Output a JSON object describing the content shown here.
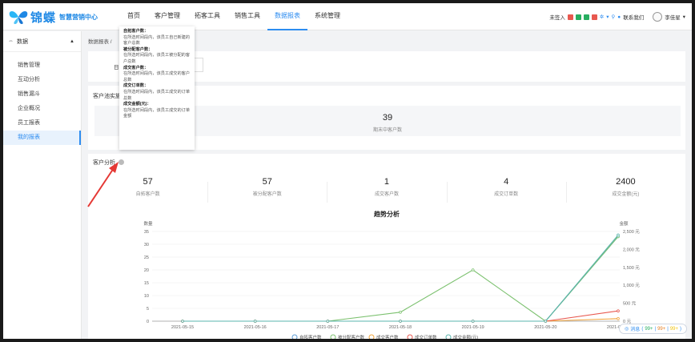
{
  "header": {
    "logo_text": "锦蝶",
    "logo_sub": "智慧营销中心",
    "nav": [
      "首页",
      "客户管理",
      "拓客工具",
      "销售工具",
      "数据报表",
      "系统管理"
    ],
    "nav_active_index": 4,
    "checkin_label": "未签入",
    "contact_label": "联系我们",
    "user_name": "李佳星"
  },
  "sidebar": {
    "group_label": "数据",
    "items": [
      "销售管理",
      "互动分析",
      "销售漏斗",
      "企业概况",
      "员工报表",
      "我的报表"
    ],
    "active_index": 5
  },
  "breadcrumb": "数据报表 /",
  "filter_label": "日",
  "pool_section": {
    "title": "客户池实施",
    "value": "39",
    "label": "期末中客户数"
  },
  "analysis": {
    "title": "客户分析",
    "stats": [
      {
        "value": "57",
        "label": "自拓客户数"
      },
      {
        "value": "57",
        "label": "被分配客户数"
      },
      {
        "value": "1",
        "label": "成交客户数"
      },
      {
        "value": "4",
        "label": "成交订单数"
      },
      {
        "value": "2400",
        "label": "成交金额(元)"
      }
    ]
  },
  "tooltip": {
    "entries": [
      {
        "title": "自拓客户数：",
        "desc": "在所选时间段内，该员工自己新建的客户总数"
      },
      {
        "title": "被分配客户数：",
        "desc": "在所选时间段内，该员工被分配的客户总数"
      },
      {
        "title": "成交客户数：",
        "desc": "在所选时间段内，该员工成交的客户总数"
      },
      {
        "title": "成交订单数：",
        "desc": "在所选时间段内，该员工成交的订单总数"
      },
      {
        "title": "成交金额(元)：",
        "desc": "在所选时间段内，该员工成交的订单金额"
      }
    ]
  },
  "chat": {
    "label": "消息",
    "n1": "99+",
    "n2": "99+",
    "n3": "99+"
  },
  "colors": {
    "accent": "#2d8cf0",
    "blue": "#5b9bd5",
    "green": "#7cc16f",
    "orange": "#f0a33b",
    "red": "#e8584f",
    "teal": "#5ab4ac"
  },
  "chart_data": {
    "type": "line",
    "title": "趋势分析",
    "ylabel_left": "数量",
    "ylabel_right": "金额",
    "x": [
      "2021-05-15",
      "2021-05-16",
      "2021-05-17",
      "2021-05-18",
      "2021-05-19",
      "2021-05-20",
      "2021-05-21"
    ],
    "ylim_left": [
      0,
      35
    ],
    "yticks_left": [
      0,
      5,
      10,
      15,
      20,
      25,
      30,
      35
    ],
    "ylim_right": [
      0,
      2500
    ],
    "yticks_right": [
      "0 元",
      "500 元",
      "1,000 元",
      "1,500 元",
      "2,000 元",
      "2,500 元"
    ],
    "series": [
      {
        "name": "自拓客户数",
        "axis": "left",
        "color": "#5b9bd5",
        "values": [
          0,
          0,
          0,
          0,
          0,
          0,
          33
        ]
      },
      {
        "name": "被分配客户数",
        "axis": "left",
        "color": "#7cc16f",
        "values": [
          0,
          0,
          0,
          3.5,
          20,
          0,
          33
        ]
      },
      {
        "name": "成交客户数",
        "axis": "left",
        "color": "#f0a33b",
        "values": [
          0,
          0,
          0,
          0,
          0,
          0,
          1
        ]
      },
      {
        "name": "成交订单数",
        "axis": "left",
        "color": "#e8584f",
        "values": [
          0,
          0,
          0,
          0,
          0,
          0,
          4
        ]
      },
      {
        "name": "成交金额(元)",
        "axis": "right",
        "color": "#5ab4ac",
        "values": [
          0,
          0,
          0,
          0,
          0,
          0,
          2400
        ]
      }
    ]
  }
}
